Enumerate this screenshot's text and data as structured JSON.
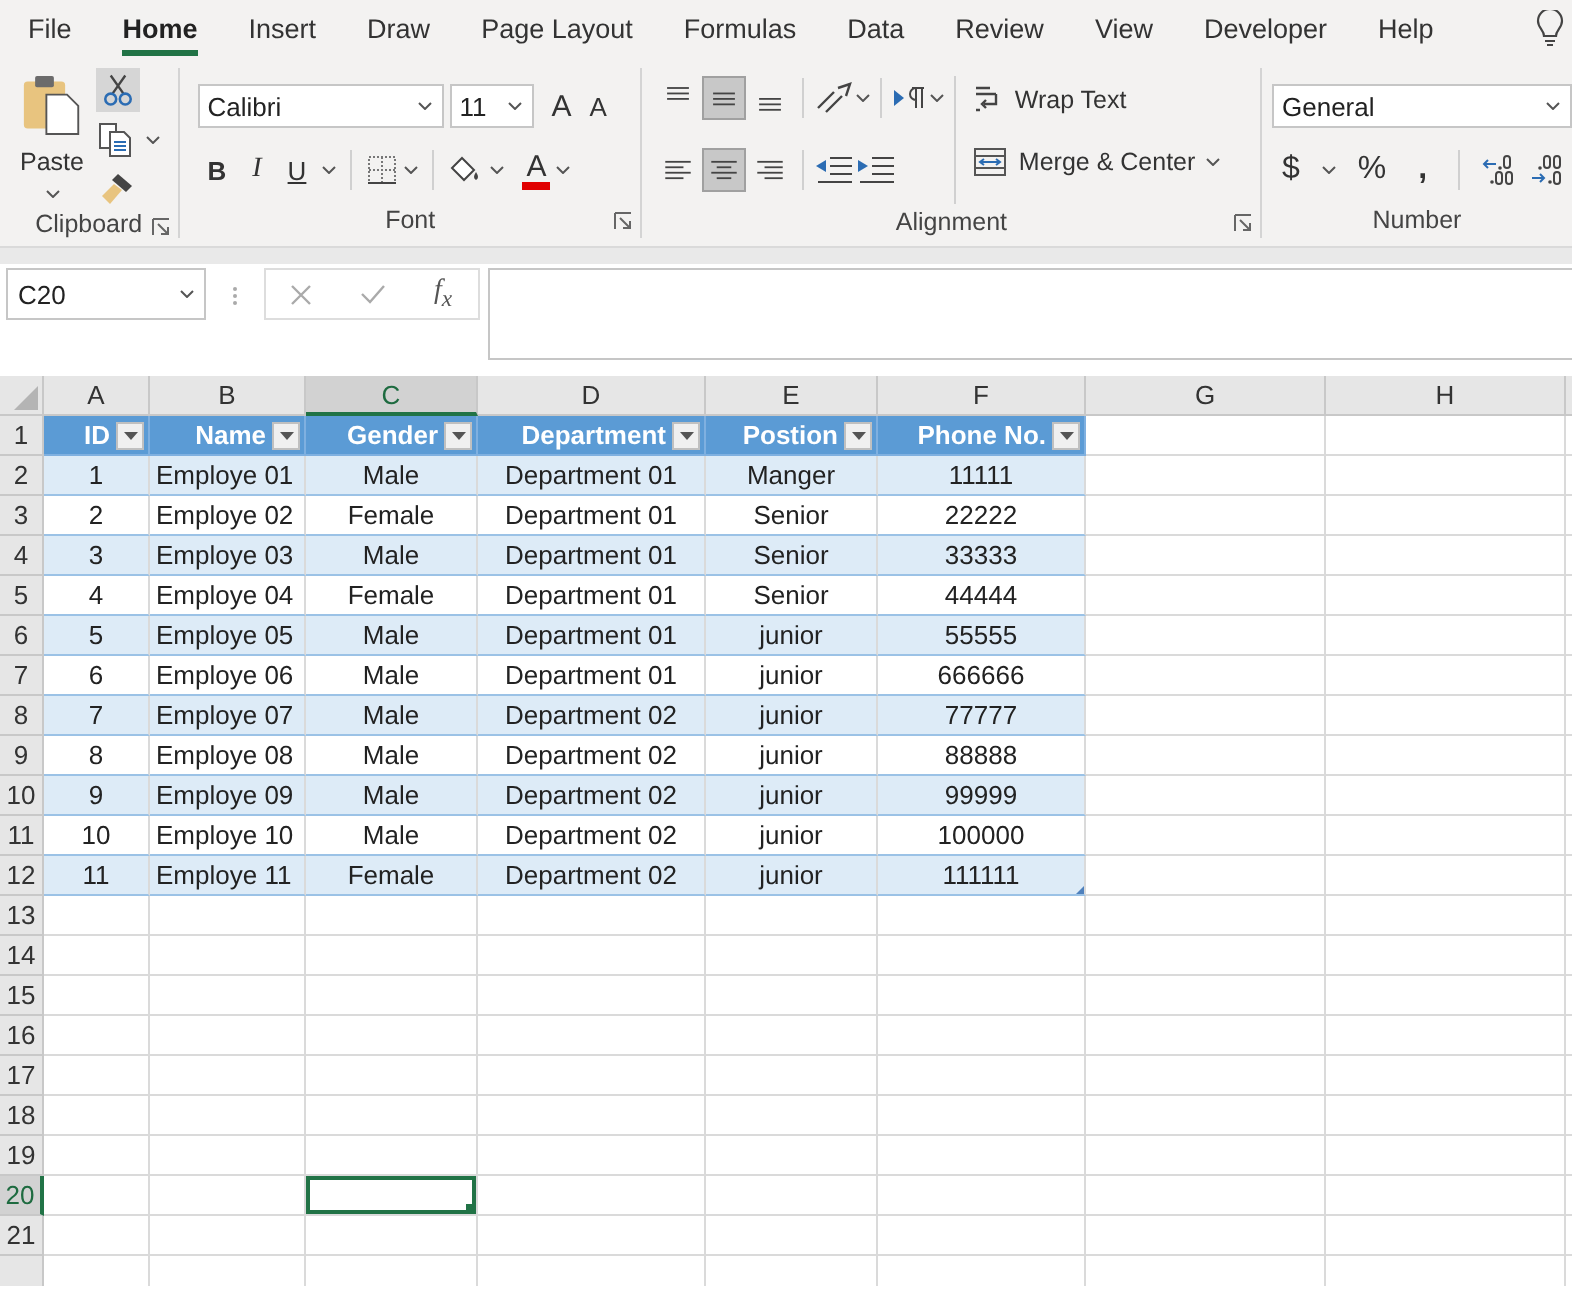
{
  "ribbon_tabs": [
    {
      "label": "File",
      "selected": false
    },
    {
      "label": "Home",
      "selected": true
    },
    {
      "label": "Insert",
      "selected": false
    },
    {
      "label": "Draw",
      "selected": false
    },
    {
      "label": "Page Layout",
      "selected": false
    },
    {
      "label": "Formulas",
      "selected": false
    },
    {
      "label": "Data",
      "selected": false
    },
    {
      "label": "Review",
      "selected": false
    },
    {
      "label": "View",
      "selected": false
    },
    {
      "label": "Developer",
      "selected": false
    },
    {
      "label": "Help",
      "selected": false
    }
  ],
  "clipboard": {
    "paste": "Paste",
    "cut_highlighted": true,
    "group_label": "Clipboard"
  },
  "font": {
    "font_name": "Calibri",
    "font_size": "11",
    "grow": "A",
    "shrink": "A",
    "bold": "B",
    "italic": "I",
    "underline": "U",
    "font_color": "A",
    "group_label": "Font"
  },
  "alignment": {
    "vertical": [
      {
        "kind": "top",
        "selected": false
      },
      {
        "kind": "middle",
        "selected": true
      },
      {
        "kind": "bottom",
        "selected": false
      }
    ],
    "horizontal": [
      {
        "kind": "left",
        "selected": false
      },
      {
        "kind": "center",
        "selected": true
      },
      {
        "kind": "right",
        "selected": false
      }
    ],
    "wrap_text": "Wrap Text",
    "merge_center": "Merge & Center",
    "group_label": "Alignment"
  },
  "number": {
    "format": "General",
    "currency": "$",
    "percent": "%",
    "comma": ",",
    "group_label": "Number"
  },
  "formula_bar": {
    "name_box": "C20",
    "function_label": "f$_{x}$"
  },
  "grid": {
    "columns": [
      {
        "label": "A",
        "selected": false
      },
      {
        "label": "B",
        "selected": false
      },
      {
        "label": "C",
        "selected": true
      },
      {
        "label": "D",
        "selected": false
      },
      {
        "label": "E",
        "selected": false
      },
      {
        "label": "F",
        "selected": false
      },
      {
        "label": "G",
        "selected": false
      },
      {
        "label": "H",
        "selected": false
      }
    ],
    "rows": [
      {
        "label": "1",
        "selected": false
      },
      {
        "label": "2",
        "selected": false
      },
      {
        "label": "3",
        "selected": false
      },
      {
        "label": "4",
        "selected": false
      },
      {
        "label": "5",
        "selected": false
      },
      {
        "label": "6",
        "selected": false
      },
      {
        "label": "7",
        "selected": false
      },
      {
        "label": "8",
        "selected": false
      },
      {
        "label": "9",
        "selected": false
      },
      {
        "label": "10",
        "selected": false
      },
      {
        "label": "11",
        "selected": false
      },
      {
        "label": "12",
        "selected": false
      },
      {
        "label": "13",
        "selected": false
      },
      {
        "label": "14",
        "selected": false
      },
      {
        "label": "15",
        "selected": false
      },
      {
        "label": "16",
        "selected": false
      },
      {
        "label": "17",
        "selected": false
      },
      {
        "label": "18",
        "selected": false
      },
      {
        "label": "19",
        "selected": false
      },
      {
        "label": "20",
        "selected": true
      },
      {
        "label": "21",
        "selected": false
      }
    ]
  },
  "table": {
    "columns": [
      "ID",
      "Name",
      "Gender",
      "Department",
      "Postion",
      "Phone No."
    ],
    "rows": [
      [
        "1",
        "Employe 01",
        "Male",
        "Department 01",
        "Manger",
        "11111"
      ],
      [
        "2",
        "Employe 02",
        "Female",
        "Department 01",
        "Senior",
        "22222"
      ],
      [
        "3",
        "Employe 03",
        "Male",
        "Department 01",
        "Senior",
        "33333"
      ],
      [
        "4",
        "Employe 04",
        "Female",
        "Department 01",
        "Senior",
        "44444"
      ],
      [
        "5",
        "Employe 05",
        "Male",
        "Department 01",
        "junior",
        "55555"
      ],
      [
        "6",
        "Employe 06",
        "Male",
        "Department 01",
        "junior",
        "666666"
      ],
      [
        "7",
        "Employe 07",
        "Male",
        "Department 02",
        "junior",
        "77777"
      ],
      [
        "8",
        "Employe 08",
        "Male",
        "Department 02",
        "junior",
        "88888"
      ],
      [
        "9",
        "Employe 09",
        "Male",
        "Department 02",
        "junior",
        "99999"
      ],
      [
        "10",
        "Employe 10",
        "Male",
        "Department 02",
        "junior",
        "100000"
      ],
      [
        "11",
        "Employe 11",
        "Female",
        "Department 02",
        "junior",
        "111111"
      ]
    ]
  }
}
